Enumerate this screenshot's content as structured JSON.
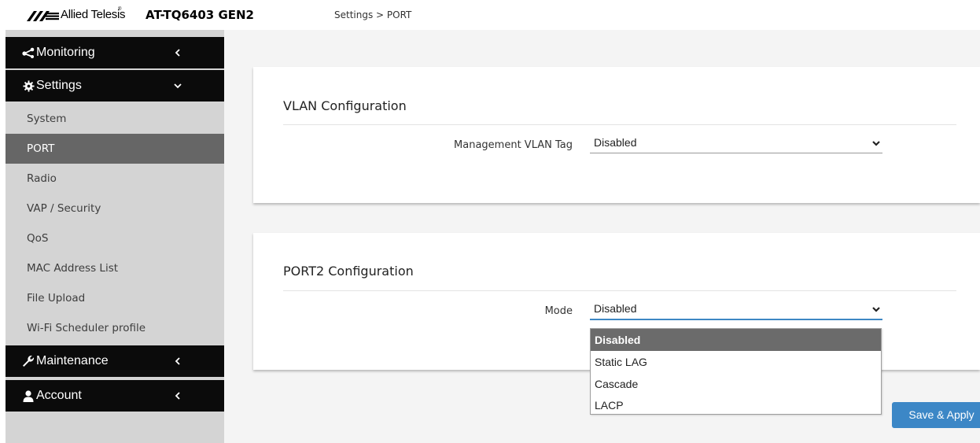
{
  "header": {
    "brand_text": "Allied Telesis",
    "brand_reg": "®",
    "model": "AT-TQ6403 GEN2",
    "breadcrumb": "Settings > PORT"
  },
  "sidebar": {
    "monitoring": {
      "label": "Monitoring",
      "icon": "share-icon",
      "expanded": false
    },
    "settings": {
      "label": "Settings",
      "icon": "gear-icon",
      "expanded": true,
      "items": [
        {
          "label": "System"
        },
        {
          "label": "PORT",
          "active": true
        },
        {
          "label": "Radio"
        },
        {
          "label": "VAP / Security"
        },
        {
          "label": "QoS"
        },
        {
          "label": "MAC Address List"
        },
        {
          "label": "File Upload"
        },
        {
          "label": "Wi-Fi Scheduler profile"
        }
      ]
    },
    "maintenance": {
      "label": "Maintenance",
      "icon": "wrench-icon",
      "expanded": false
    },
    "account": {
      "label": "Account",
      "icon": "user-icon",
      "expanded": false
    }
  },
  "vlan": {
    "title": "VLAN Configuration",
    "mgmt_label": "Management VLAN Tag",
    "mgmt_value": "Disabled"
  },
  "port2": {
    "title": "PORT2 Configuration",
    "mode_label": "Mode",
    "mode_value": "Disabled",
    "mode_options": [
      "Disabled",
      "Static LAG",
      "Cascade",
      "LACP"
    ],
    "mode_selected_index": 0
  },
  "actions": {
    "save_label": "Save & Apply"
  },
  "colors": {
    "nav_header_bg": "#0b0b0b",
    "sidebar_bg": "#d4d4d4",
    "active_item_bg": "#666666",
    "accent": "#3c87c6",
    "main_bg": "#f4f4f4"
  }
}
